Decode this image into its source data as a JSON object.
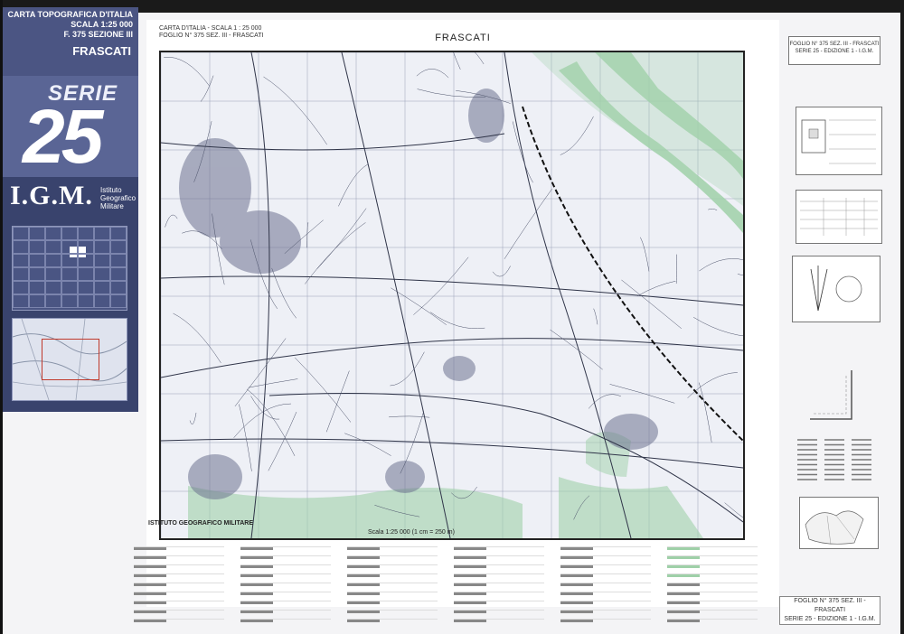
{
  "cover": {
    "line1": "CARTA TOPOGRAFICA D'ITALIA",
    "line2": "SCALA 1:25 000",
    "line3": "F. 375 SEZIONE III",
    "sheet_name": "FRASCATI",
    "serie_word": "SERIE",
    "serie_number": "25",
    "igm_logo": "I.G.M.",
    "igm_line1": "Istituto",
    "igm_line2": "Geografico",
    "igm_line3": "Militare"
  },
  "sheet": {
    "header_line1": "CARTA D'ITALIA - SCALA 1 : 25 000",
    "header_line2": "FOGLIO N° 375 SEZ. III - FRASCATI",
    "title": "FRASCATI",
    "scale_label": "Scala 1:25 000 (1 cm = 250 m)",
    "publisher": "ISTITUTO GEOGRAFICO MILITARE"
  },
  "right_panel": {
    "top_line1": "FOGLIO N° 375 SEZ. III - FRASCATI",
    "top_line2": "SERIE 25 - EDIZIONE 1 - I.G.M.",
    "footer_line1": "FOGLIO N° 375 SEZ. III - FRASCATI",
    "footer_line2": "SERIE 25 - EDIZIONE 1 - I.G.M."
  },
  "colors": {
    "cover_bg": "#39436d",
    "cover_accent": "#5a6595",
    "forest_green": "#8fc79a",
    "map_line": "#3a3f55"
  }
}
